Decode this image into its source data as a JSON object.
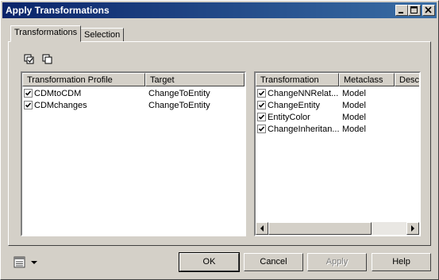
{
  "window": {
    "title": "Apply Transformations"
  },
  "tabs": [
    {
      "label": "Transformations",
      "active": true
    },
    {
      "label": "Selection",
      "active": false
    }
  ],
  "toolbar": {
    "icons": [
      "select-all-icon",
      "deselect-all-icon"
    ]
  },
  "left_list": {
    "columns": [
      "Transformation Profile",
      "Target"
    ],
    "rows": [
      {
        "checked": true,
        "profile": "CDMtoCDM",
        "target": "ChangeToEntity"
      },
      {
        "checked": true,
        "profile": "CDMchanges",
        "target": "ChangeToEntity"
      }
    ]
  },
  "right_list": {
    "columns": [
      "Transformation",
      "Metaclass",
      "Desc"
    ],
    "rows": [
      {
        "checked": true,
        "name": "ChangeNNRelat...",
        "metaclass": "Model"
      },
      {
        "checked": true,
        "name": "ChangeEntity",
        "metaclass": "Model"
      },
      {
        "checked": true,
        "name": "EntityColor",
        "metaclass": "Model"
      },
      {
        "checked": true,
        "name": "ChangeInheritan...",
        "metaclass": "Model"
      }
    ]
  },
  "buttons": {
    "ok": "OK",
    "cancel": "Cancel",
    "apply": "Apply",
    "help": "Help"
  },
  "colors": {
    "titlebar_start": "#0a246a",
    "titlebar_end": "#3a6ea5",
    "face": "#d4d0c8"
  }
}
